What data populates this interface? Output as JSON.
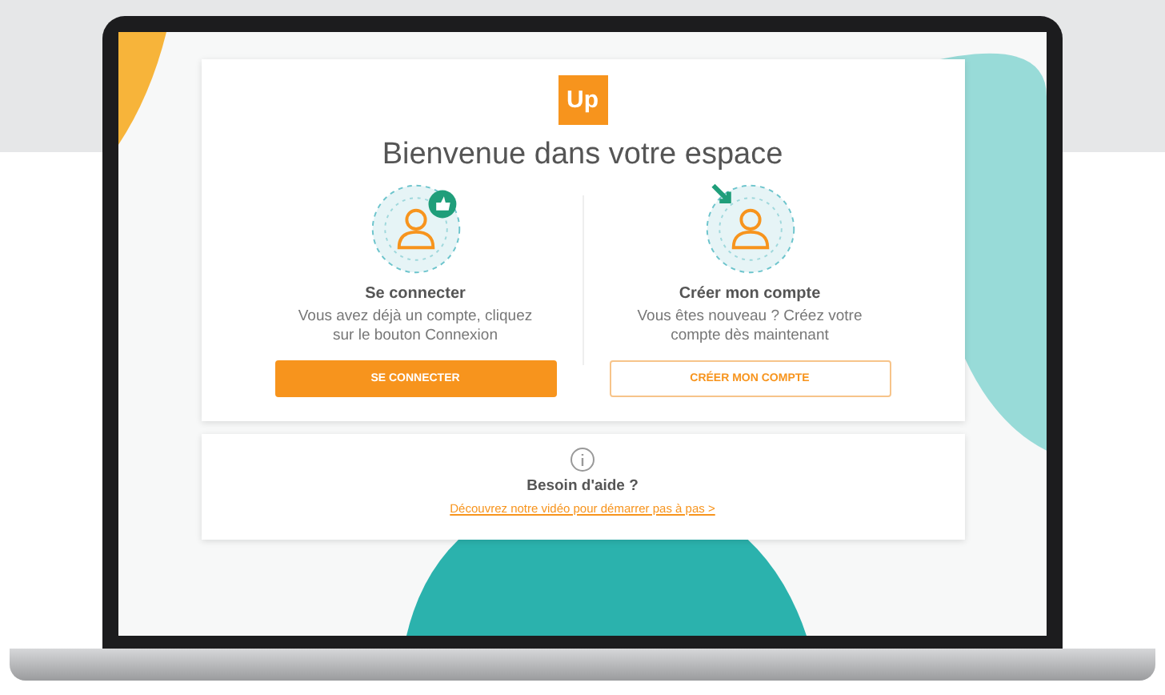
{
  "logo": {
    "text": "Up"
  },
  "title": "Bienvenue dans votre espace",
  "options": [
    {
      "kind": "login",
      "heading": "Se connecter",
      "text": "Vous avez déjà un compte, cliquez sur le bouton Connexion",
      "button": "SE CONNECTER",
      "primary": true
    },
    {
      "kind": "signup",
      "heading": "Créer mon compte",
      "text": "Vous êtes nouveau ? Créez votre compte dès maintenant",
      "button": "CRÉER MON COMPTE",
      "primary": false
    }
  ],
  "help": {
    "heading": "Besoin d'aide ?",
    "link": "Découvrez notre vidéo pour démarrer pas à pas >"
  }
}
